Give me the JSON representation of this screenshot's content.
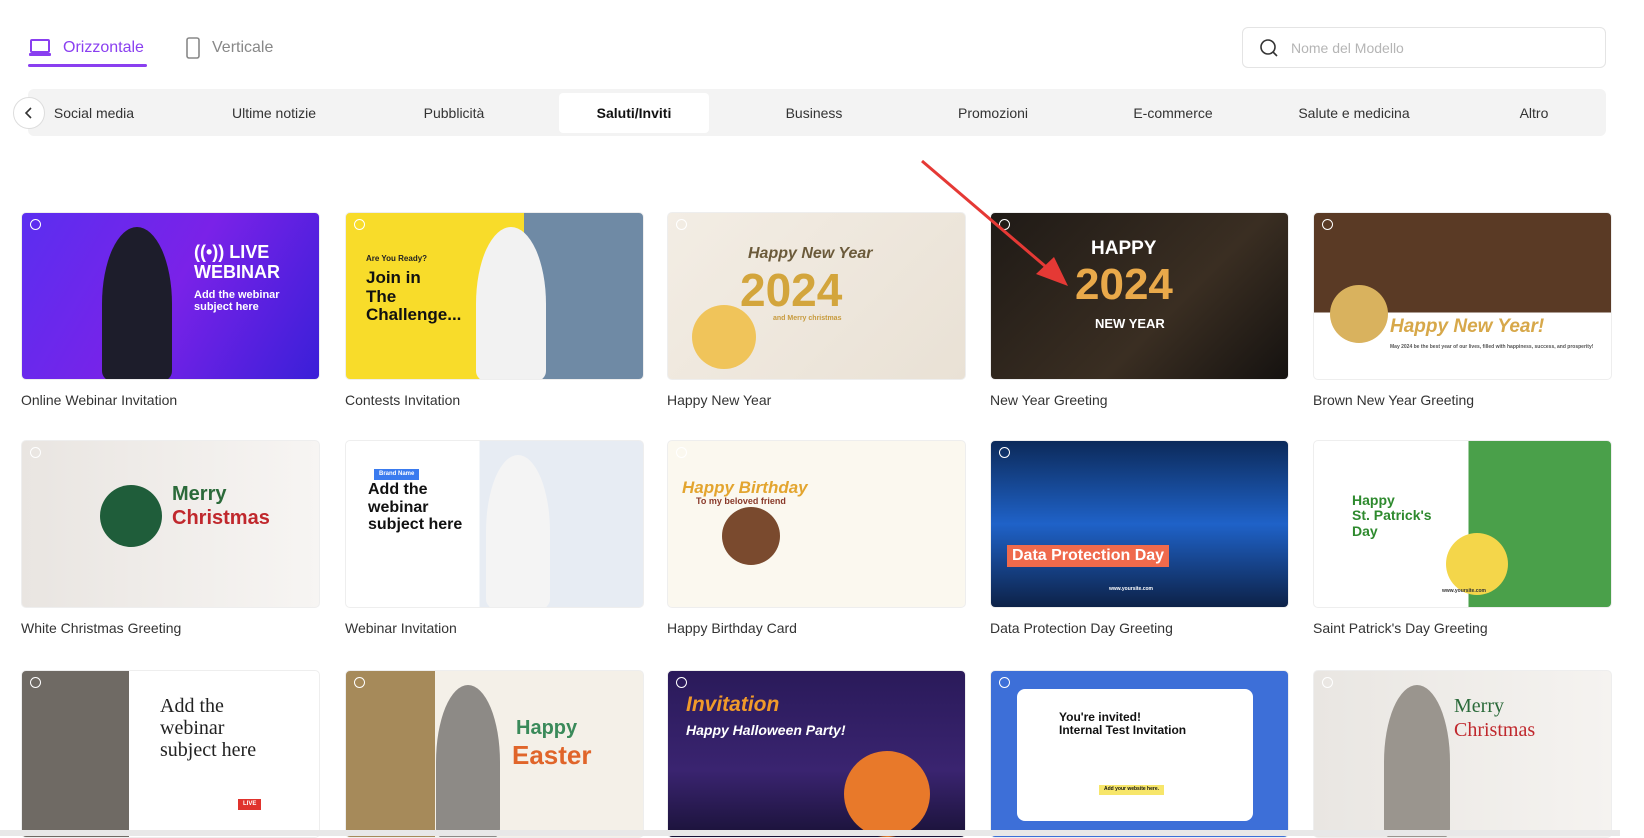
{
  "orientation_tabs": [
    {
      "label": "Orizzontale",
      "icon": "laptop-icon",
      "active": true
    },
    {
      "label": "Verticale",
      "icon": "phone-icon",
      "active": false
    }
  ],
  "search": {
    "placeholder": "Nome del Modello",
    "value": ""
  },
  "categories": [
    "Social media",
    "Ultime notizie",
    "Pubblicità",
    "Saluti/Inviti",
    "Business",
    "Promozioni",
    "E-commerce",
    "Salute e medicina",
    "Altro"
  ],
  "active_category": "Saluti/Inviti",
  "colors": {
    "accent": "#8a3ff0",
    "annotation_arrow": "#e53935"
  },
  "templates": [
    {
      "title": "Online Webinar Invitation",
      "lines": [
        "((•)) LIVE\nWEBINAR",
        "Add the webinar\nsubject here"
      ]
    },
    {
      "title": "Contests Invitation",
      "lines": [
        "Are You Ready?",
        "Join in\nThe\nChallenge..."
      ]
    },
    {
      "title": "Happy New Year",
      "lines": [
        "Happy New Year",
        "2024",
        "and Merry christmas"
      ]
    },
    {
      "title": "New Year Greeting",
      "lines": [
        "HAPPY",
        "2024",
        "NEW YEAR"
      ]
    },
    {
      "title": "Brown New Year Greeting",
      "lines": [
        "Happy New Year!",
        "May 2024 be the best year of our lives, filled with happiness, success, and prosperity!"
      ]
    },
    {
      "title": "White Christmas Greeting",
      "lines": [
        "Merry",
        "Christmas"
      ]
    },
    {
      "title": "Webinar Invitation",
      "lines": [
        "Brand Name",
        "Add the\nwebinar\nsubject here"
      ]
    },
    {
      "title": "Happy Birthday Card",
      "lines": [
        "Happy Birthday",
        "To my beloved friend"
      ]
    },
    {
      "title": "Data Protection Day Greeting",
      "lines": [
        "Data Protection Day",
        "www.yoursite.com"
      ]
    },
    {
      "title": "Saint Patrick's Day Greeting",
      "lines": [
        "Happy\nSt. Patrick's\nDay",
        "www.yoursite.com"
      ]
    },
    {
      "title": "",
      "lines": [
        "Add the\nwebinar\nsubject here",
        "LIVE"
      ]
    },
    {
      "title": "",
      "lines": [
        "Happy",
        "Easter"
      ]
    },
    {
      "title": "",
      "lines": [
        "Invitation",
        "Happy Halloween Party!"
      ]
    },
    {
      "title": "",
      "lines": [
        "You're invited!\nInternal Test Invitation",
        "Add your website here."
      ]
    },
    {
      "title": "",
      "lines": [
        "Merry",
        "Christmas"
      ]
    }
  ]
}
